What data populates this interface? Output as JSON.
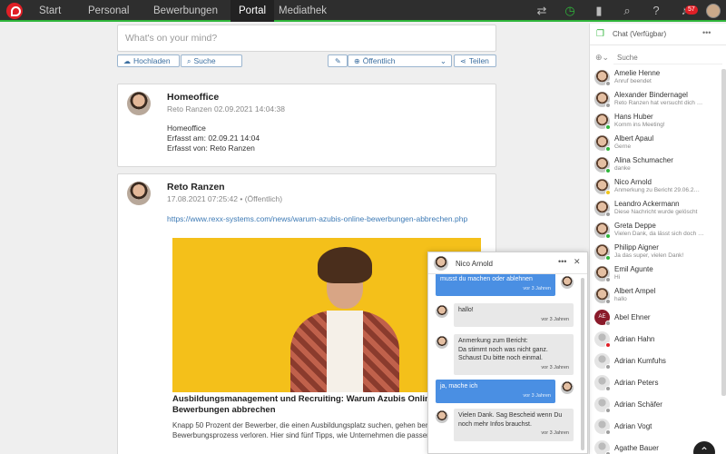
{
  "nav": {
    "tabs": [
      {
        "label": "Start"
      },
      {
        "label": "Personal"
      },
      {
        "label": "Bewerbungen"
      },
      {
        "label": "Portal"
      },
      {
        "label": "Mediathek"
      }
    ],
    "active_tab": "Portal",
    "notification_count": "57",
    "icons": [
      "swap-icon",
      "timer-icon",
      "bookmark-icon",
      "search-icon",
      "help-icon",
      "bell-icon"
    ]
  },
  "compose": {
    "placeholder": "What's on your mind?",
    "upload_label": "Hochladen",
    "search_label": "Suche",
    "visibility_label": "Öffentlich",
    "share_label": "Teilen"
  },
  "posts": [
    {
      "author": "Homeoffice",
      "meta": "Reto Ranzen 02.09.2021 14:04:38",
      "lines": [
        "Homeoffice",
        "Erfasst am: 02.09.21 14:04",
        "Erfasst von: Reto Ranzen"
      ]
    },
    {
      "author": "Reto Ranzen",
      "meta": "17.08.2021 07:25:42 • (Öffentlich)",
      "link": "https://www.rexx-systems.com/news/warum-azubis-online-bewerbungen-abbrechen.php",
      "title": "Ausbildungsmanagement und Recruiting: Warum Azubis Online-Bewerbungen abbrechen",
      "excerpt": "Knapp 50 Prozent der Bewerber, die einen Ausbildungsplatz suchen, gehen bereits in der Bewerbungsprozess verloren. Hier sind fünf Tipps, wie Unternehmen die passenden"
    }
  ],
  "chat": {
    "title": "Chat (Verfügbar)",
    "search_placeholder": "Suche",
    "contacts": [
      {
        "name": "Amelie Henne",
        "status": "Anruf beendet",
        "dot": "#9e9e9e"
      },
      {
        "name": "Alexander Bindernagel",
        "status": "Reto Ranzen hat versucht dich …",
        "dot": "#9e9e9e"
      },
      {
        "name": "Hans Huber",
        "status": "Komm ins Meeting!",
        "dot": "#2fb53a"
      },
      {
        "name": "Albert Apaul",
        "status": "Gerne",
        "dot": "#2fb53a"
      },
      {
        "name": "Alina Schumacher",
        "status": "danke",
        "dot": "#2fb53a"
      },
      {
        "name": "Nico Arnold",
        "status": "Anmerkung zu Bericht 29.06.2…",
        "dot": "#f0c419"
      },
      {
        "name": "Leandro Ackermann",
        "status": "Diese Nachricht wurde gelöscht",
        "dot": "#9e9e9e"
      },
      {
        "name": "Greta Deppe",
        "status": "Vielen Dank, da lässt sich doch …",
        "dot": "#2fb53a"
      },
      {
        "name": "Philipp Aigner",
        "status": "Ja das super, vielen Dank!",
        "dot": "#2fb53a"
      },
      {
        "name": "Emil Agunte",
        "status": "Hi",
        "dot": "#9e9e9e"
      },
      {
        "name": "Albert Ampel",
        "status": "hallo",
        "dot": "#9e9e9e"
      },
      {
        "name": "Abel Ehner",
        "status": "",
        "dot": "#9e9e9e",
        "initials": "AE"
      },
      {
        "name": "Adrian Hahn",
        "status": "",
        "dot": "#e01f26"
      },
      {
        "name": "Adrian Kumfuhs",
        "status": "",
        "dot": "#9e9e9e"
      },
      {
        "name": "Adrian Peters",
        "status": "",
        "dot": "#9e9e9e"
      },
      {
        "name": "Adrian Schäfer",
        "status": "",
        "dot": "#9e9e9e"
      },
      {
        "name": "Adrian Vogt",
        "status": "",
        "dot": "#9e9e9e"
      },
      {
        "name": "Agathe Bauer",
        "status": "",
        "dot": "#9e9e9e"
      }
    ]
  },
  "chat_window": {
    "name": "Nico Arnold",
    "messages": [
      {
        "dir": "out",
        "text": "musst du machen oder ablehnen",
        "time": "vor 3 Jahren"
      },
      {
        "dir": "in",
        "text": "hallo!",
        "time": "vor 3 Jahren"
      },
      {
        "dir": "in",
        "text": "Anmerkung zum Bericht:\nDa stimmt noch was nicht ganz. Schaust Du bitte noch einmal.",
        "time": "vor 3 Jahren"
      },
      {
        "dir": "out",
        "text": "ja, mache ich",
        "time": "vor 3 Jahren"
      },
      {
        "dir": "in",
        "text": "Vielen Dank. Sag Bescheid wenn Du noch mehr Infos brauchst.",
        "time": "vor 3 Jahren"
      }
    ]
  },
  "colors": {
    "accent_green": "#2fb53a",
    "brand_red": "#e01f26",
    "link_blue": "#3d7ab5",
    "message_blue": "#4a8fe3"
  }
}
